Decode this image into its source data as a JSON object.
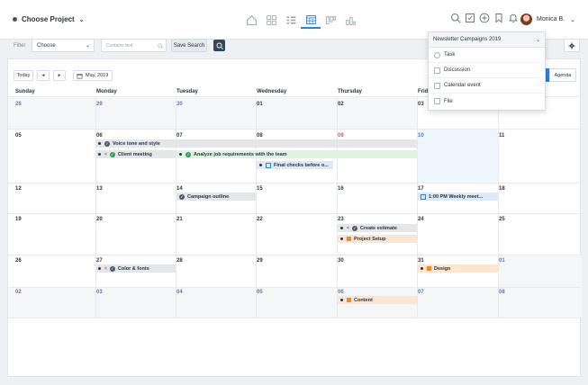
{
  "topbar": {
    "project_label": "Choose Project",
    "user_name": "Monica B."
  },
  "filter": {
    "label": "Filter",
    "choose_value": "Choose",
    "search_placeholder": "Contains text",
    "save_search_label": "Save Search"
  },
  "toolbar": {
    "today_label": "Today",
    "prev_label": "◂",
    "next_label": "▸",
    "month_label": "May, 2019",
    "agenda_label": "Agenda"
  },
  "dropdown": {
    "title": "Newsletter Campaigns 2019",
    "items": [
      {
        "label": "Task"
      },
      {
        "label": "Discussion"
      },
      {
        "label": "Calendar event"
      },
      {
        "label": "File"
      }
    ]
  },
  "calendar": {
    "day_names": [
      "Sunday",
      "Monday",
      "Tuesday",
      "Wednesday",
      "Thursday",
      "Frid",
      ""
    ],
    "weeks": [
      [
        "28",
        "29",
        "30",
        "01",
        "02",
        "03",
        ""
      ],
      [
        "05",
        "06",
        "07",
        "08",
        "09",
        "10",
        "11"
      ],
      [
        "12",
        "13",
        "14",
        "15",
        "16",
        "17",
        "18"
      ],
      [
        "19",
        "20",
        "21",
        "22",
        "23",
        "24",
        "25"
      ],
      [
        "26",
        "27",
        "28",
        "29",
        "30",
        "31",
        "01"
      ],
      [
        "02",
        "03",
        "04",
        "05",
        "06",
        "07",
        "08"
      ]
    ],
    "events": {
      "voice_tone": "Voice tone and style",
      "client_meeting": "Client meeting",
      "analyze_job": "Analyze job requirements with the team",
      "final_checks": "Final checks before o...",
      "campaign_outline": "Campaign outline",
      "weekly_meet": "1:00 PM  Weekly meet...",
      "create_estimate": "Create estimate",
      "project_setup": "Project Setup",
      "color_fonts": "Color & fonts",
      "design": "Design",
      "content": "Content"
    }
  },
  "colors": {
    "accent": "#2f7fe0",
    "green_event": "#dff3e3",
    "orange_event": "#fde5cf",
    "today_number": "#e2553c"
  }
}
